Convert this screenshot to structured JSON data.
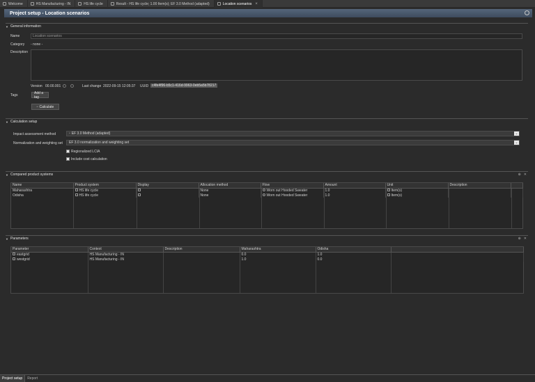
{
  "tabs": [
    {
      "label": "Welcome"
    },
    {
      "label": "HS Manufacturing - IN"
    },
    {
      "label": "HS life cycle"
    },
    {
      "label": "Result - HS life cycle; 1.00 Item(s); EF 3.0 Method (adapted)"
    },
    {
      "label": "Location scenarios"
    }
  ],
  "page_title": "Project setup - Location scenarios",
  "general": {
    "header": "General information",
    "name_label": "Name",
    "name_value": "Location scenarios",
    "category_label": "Category",
    "category_value": "- none -",
    "description_label": "Description",
    "version_label": "Version",
    "version_value": "00.00.001",
    "last_change_label": "Last change",
    "last_change_value": "2022-09-15 12:05:37",
    "uuid_label": "UUID",
    "uuid_value": "c4fe4f96-b5c1-416d-9963-0eb5a5b78217",
    "tags_label": "Tags",
    "add_tag": "Add a tag",
    "calculate": "Calculate"
  },
  "calc": {
    "header": "Calculation setup",
    "method_label": "Impact assessment method",
    "method_value": "EF 3.0 Method (adapted)",
    "nw_label": "Normalization and weighting set",
    "nw_value": "EF 3.0 normalization and weighting set",
    "regionalized": "Regionalized LCIA",
    "cost": "Include cost calculation"
  },
  "compared": {
    "header": "Compared product systems",
    "columns": [
      "Name",
      "Product system",
      "Display",
      "Allocation method",
      "Flow",
      "Amount",
      "Unit",
      "Description"
    ],
    "rows": [
      {
        "name": "Maharashtra",
        "system": "HS life cycle",
        "allocation": "None",
        "flow": "Worn out Hooded Sweater",
        "amount": "1.0",
        "unit": "Item(s)"
      },
      {
        "name": "Odisha",
        "system": "HS life cycle",
        "allocation": "None",
        "flow": "Worn out Hooded Sweater",
        "amount": "1.0",
        "unit": "Item(s)"
      }
    ]
  },
  "params": {
    "header": "Parameters",
    "columns": [
      "Parameter",
      "Context",
      "Description",
      "Maharashtra",
      "Odisha"
    ],
    "rows": [
      {
        "name": "eastgrid",
        "context": "HS Manufacturing - IN",
        "mah": "0.0",
        "odi": "1.0"
      },
      {
        "name": "westgrid",
        "context": "HS Manufacturing - IN",
        "mah": "1.0",
        "odi": "0.0"
      }
    ]
  },
  "bottom_tabs": [
    "Project setup",
    "Report"
  ]
}
